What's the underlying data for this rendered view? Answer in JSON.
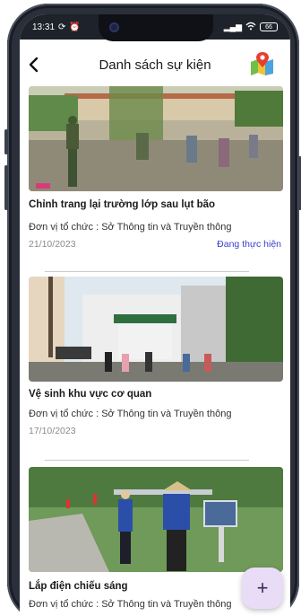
{
  "status_bar": {
    "time": "13:31",
    "battery": "66"
  },
  "header": {
    "title": "Danh sách sự kiện",
    "back_icon": "back-arrow-icon",
    "map_icon": "map-pin-icon"
  },
  "events": [
    {
      "title": "Chỉnh trang lại trường lớp sau lụt bão",
      "org_label": "Đơn vị tổ chức : ",
      "org": "Sở Thông tin và Truyền thông",
      "date": "21/10/2023",
      "status": "Đang thực hiện"
    },
    {
      "title": "Vệ sinh khu vực cơ quan",
      "org_label": "Đơn vị tổ chức : ",
      "org": "Sở Thông tin và Truyền thông",
      "date": "17/10/2023",
      "status": ""
    },
    {
      "title": "Lắp điện chiếu sáng",
      "org_label": "Đơn vị tổ chức : ",
      "org": "Sở Thông tin và Truyền thông",
      "date": "",
      "status": ""
    }
  ],
  "fab": {
    "label": "+"
  },
  "colors": {
    "status": "#3b3fc9",
    "fab_bg": "#e9dcf7",
    "frame": "#2a2f3a"
  }
}
